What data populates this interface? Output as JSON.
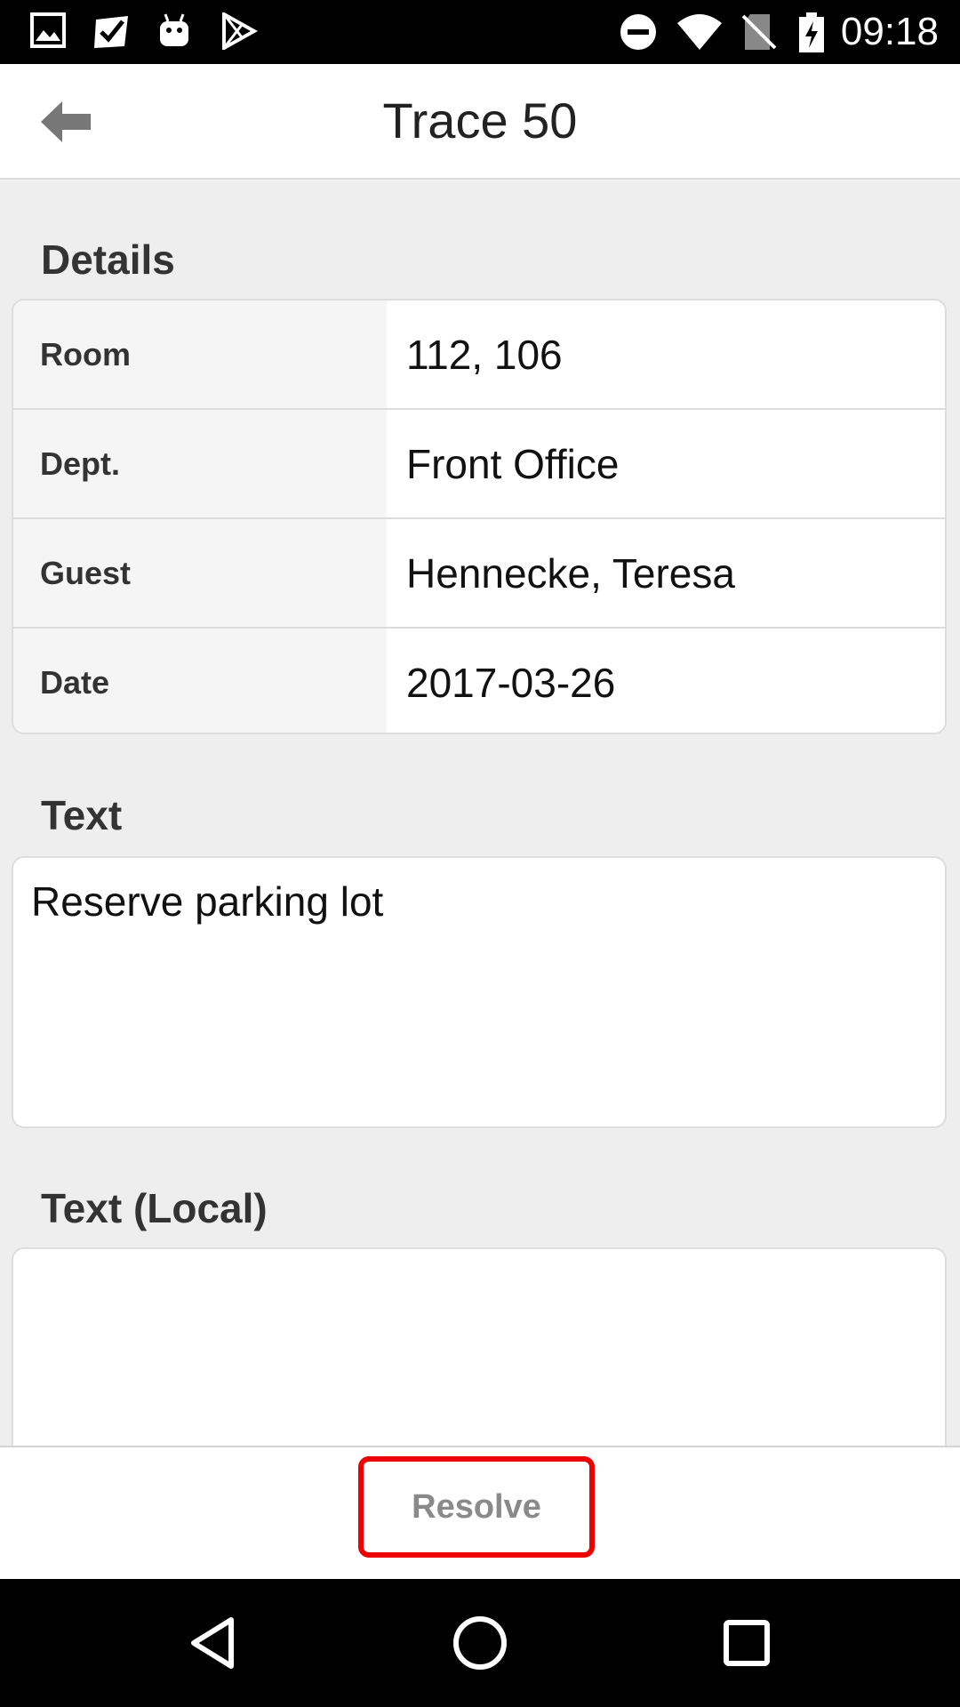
{
  "status_bar": {
    "time": "09:18",
    "icons": [
      "image-icon",
      "check-clipboard-icon",
      "android-icon",
      "play-store-icon",
      "do-not-disturb-icon",
      "wifi-icon",
      "no-sim-icon",
      "battery-charging-icon"
    ]
  },
  "app_bar": {
    "title": "Trace 50",
    "back_icon": "arrow-left-icon"
  },
  "details": {
    "heading": "Details",
    "rows": [
      {
        "label": "Room",
        "value": "112, 106"
      },
      {
        "label": "Dept.",
        "value": "Front Office"
      },
      {
        "label": "Guest",
        "value": "Hennecke, Teresa"
      },
      {
        "label": "Date",
        "value": "2017-03-26"
      }
    ]
  },
  "text_section": {
    "heading": "Text",
    "value": "Reserve parking lot"
  },
  "text_local_section": {
    "heading": "Text (Local)",
    "value": ""
  },
  "actions": {
    "resolve_label": "Resolve",
    "highlight_color": "#ee0000"
  },
  "nav_bar": {
    "icons": [
      "back-triangle-icon",
      "home-circle-icon",
      "recents-square-icon"
    ]
  }
}
